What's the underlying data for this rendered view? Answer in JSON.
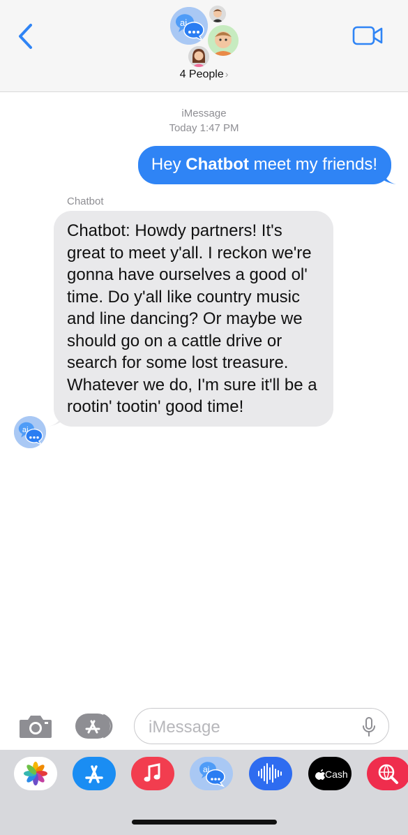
{
  "header": {
    "people_label": "4 People",
    "people_chevron": "›",
    "main_avatar_text": "ai"
  },
  "conversation": {
    "service": "iMessage",
    "timestamp": "Today 1:47 PM"
  },
  "outgoing": {
    "prefix": "Hey ",
    "bold": "Chatbot",
    "suffix": " meet my friends!"
  },
  "incoming": {
    "sender": "Chatbot",
    "text": "Chatbot: Howdy partners! It's great to meet y'all. I reckon we're gonna have ourselves a good ol' time. Do y'all like country music and line dancing? Or maybe we should go on a cattle drive or search for some lost treasure. Whatever we do, I'm sure it'll be a rootin' tootin' good time!",
    "avatar_text": "ai"
  },
  "composer": {
    "placeholder": "iMessage"
  },
  "drawer": {
    "apps": [
      {
        "name": "photos-app-icon",
        "color": "#ffffff"
      },
      {
        "name": "app-store-app-icon",
        "color": "#1a8df3"
      },
      {
        "name": "music-app-icon",
        "color": "#f23d4f"
      },
      {
        "name": "chatbot-app-icon",
        "color": "#a9c8f4",
        "label": "ai"
      },
      {
        "name": "audio-message-app-icon",
        "color": "#2e6cf0"
      },
      {
        "name": "apple-cash-app-icon",
        "color": "#000000",
        "label": "Cash"
      },
      {
        "name": "web-search-app-icon",
        "color": "#ef2d4d"
      }
    ]
  },
  "colors": {
    "accent": "#2f84f5",
    "incoming_bubble": "#e9e9eb",
    "header_bg": "#f6f6f6"
  }
}
